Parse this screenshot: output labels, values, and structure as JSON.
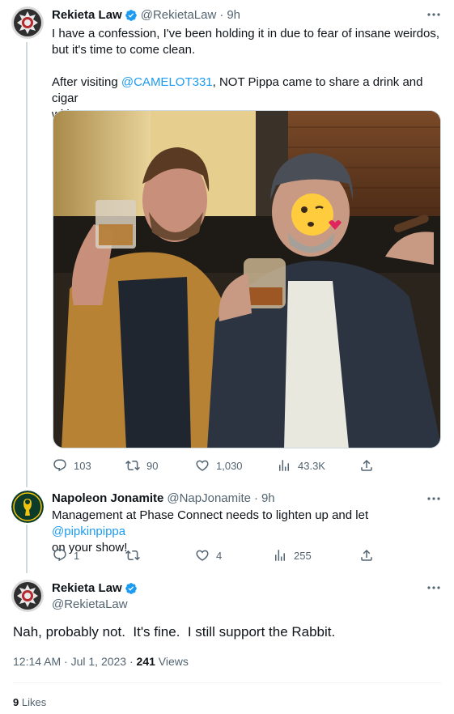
{
  "tweet1": {
    "name": "Rekieta Law",
    "handle": "@RekietaLaw",
    "time": "9h",
    "line1": "I have a confession, I've been holding it in due to fear of insane weirdos,",
    "line2": "but it's time to come clean.",
    "line3_pre": "After visiting ",
    "line3_link": "@CAMELOT331",
    "line3_post": ", NOT Pippa came to share a drink and cigar",
    "line4": "with me.",
    "replies": "103",
    "retweets": "90",
    "likes": "1,030",
    "views": "43.3K"
  },
  "tweet2": {
    "name": "Napoleon Jonamite",
    "handle": "@NapJonamite",
    "time": "9h",
    "line1_pre": "Management at Phase Connect needs to lighten up and let ",
    "line1_link": "@pipkinpippa",
    "line2": "on your show!",
    "replies": "1",
    "retweets": "",
    "likes": "4",
    "views": "255"
  },
  "main": {
    "name": "Rekieta Law",
    "handle": "@RekietaLaw",
    "text": "Nah, probably not.  It's fine.  I still support the Rabbit.",
    "timestamp": "12:14 AM · Jul 1, 2023 · ",
    "views_count": "241",
    "views_label": " Views",
    "likes_count": "9",
    "likes_label": " Likes"
  },
  "colors": {
    "accent": "#1d9bf0",
    "secondary_text": "#536471",
    "primary_text": "#0f1419"
  },
  "icons": [
    "verified-icon",
    "more-icon",
    "reply-icon",
    "retweet-icon",
    "like-icon",
    "views-icon",
    "share-icon"
  ]
}
